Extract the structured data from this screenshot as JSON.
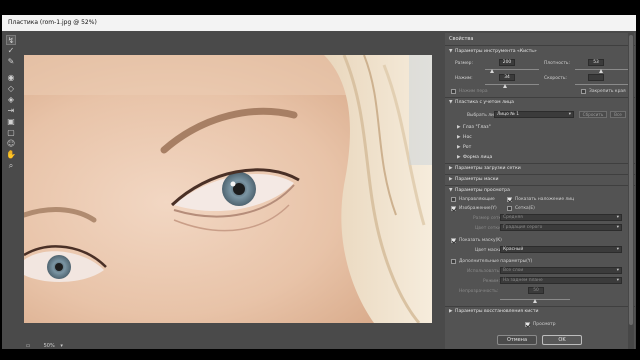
{
  "window": {
    "title": "Пластика (rom-1.jpg @ 52%)"
  },
  "toolbar": {
    "tools": [
      "warp-tool",
      "reconstruct-tool",
      "smooth-tool",
      "twirl-tool",
      "pucker-tool",
      "bloat-tool",
      "push-left-tool",
      "freeze-mask-tool",
      "thaw-mask-tool",
      "face-tool",
      "hand-tool",
      "zoom-tool"
    ]
  },
  "status": {
    "zoom": "50%"
  },
  "panel": {
    "title": "Свойства",
    "brush_section": "Параметры инструмента «Кисть»",
    "size_label": "Размер:",
    "size_value": "200",
    "density_label": "Плотность:",
    "density_value": "53",
    "pressure_label": "Нажим:",
    "pressure_value": "34",
    "rate_label": "Скорость:",
    "rate_value": "",
    "stylus_label": "Нажим пера",
    "pin_edges_label": "Закрепить края",
    "face_section": "Пластика с учетом лица",
    "select_face_label": "Выбрать лицо:",
    "select_face_value": "Лицо № 1",
    "reset_label": "Сбросить",
    "all_label": "Все",
    "face_items": [
      "Глаз \"Глаз\"",
      "Нос",
      "Рот",
      "Форма лица"
    ],
    "load_mesh_section": "Параметры загрузки сетки",
    "mask_section": "Параметры маски",
    "view_section": "Параметры просмотра",
    "guides_label": "Направляющие",
    "face_overlay_label": "Показать наложение лиц",
    "image_label": "Изображение(Y)",
    "mesh_label": "Сетка(E)",
    "mesh_size_label": "Размер сетки:",
    "mesh_size_value": "Средняя",
    "mesh_color_label": "Цвет сетки:",
    "mesh_color_value": "Градация серого",
    "show_mask_label": "Показать маску(K)",
    "mask_color_label": "Цвет маски:",
    "mask_color_value": "Красный",
    "extra_label": "Дополнительные параметры(Y)",
    "use_label": "Использовать:",
    "use_value": "Все слои",
    "mode_label": "Режим:",
    "mode_value": "На заднем плане",
    "opacity_label": "Непрозрачность:",
    "opacity_value": "50",
    "reconstruct_section": "Параметры восстановления кисти",
    "preview_label": "Просмотр",
    "cancel_label": "Отмена",
    "ok_label": "OK"
  }
}
